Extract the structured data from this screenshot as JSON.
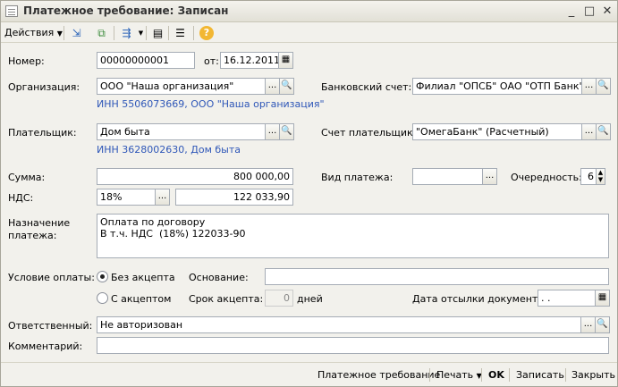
{
  "window": {
    "title": "Платежное требование: Записан",
    "minimize": "_",
    "maximize": "□",
    "close": "✕"
  },
  "toolbar": {
    "actions_label": "Действия",
    "help": "?"
  },
  "form": {
    "number_label": "Номер:",
    "number_value": "00000000001",
    "from_label": "от:",
    "date_value": "16.12.2011",
    "org_label": "Организация:",
    "org_value": "ООО \"Наша организация\"",
    "org_inn": "ИНН 5506073669, ООО \"Наша организация\"",
    "bank_account_label": "Банковский счет:",
    "bank_account_value": "Филиал \"ОПСБ\" ОАО \"ОТП Банк\" (Р",
    "payer_label": "Плательщик:",
    "payer_value": "Дом  быта",
    "payer_inn": "ИНН 3628002630, Дом  быта",
    "payer_account_label": "Счет плательщика:",
    "payer_account_value": "\"ОмегаБанк\" (Расчетный)",
    "sum_label": "Сумма:",
    "sum_value": "800 000,00",
    "payment_type_label": "Вид платежа:",
    "payment_type_value": "",
    "priority_label": "Очередность:",
    "priority_value": "6",
    "vat_label": "НДС:",
    "vat_rate": "18%",
    "vat_sum": "122 033,90",
    "purpose_label_1": "Назначение",
    "purpose_label_2": "платежа:",
    "purpose_text": "Оплата по договору\nВ т.ч. НДС  (18%) 122033-90",
    "payment_condition_label": "Условие оплаты:",
    "without_acceptance": "Без акцепта",
    "with_acceptance": "С акцептом",
    "basis_label": "Основание:",
    "basis_value": "",
    "acceptance_term_label": "Срок акцепта:",
    "acceptance_term_value": "0",
    "days_label": "дней",
    "docs_date_label": "Дата отсылки документов:",
    "docs_date_value": " .  .",
    "responsible_label": "Ответственный:",
    "responsible_value": "Не авторизован",
    "comment_label": "Комментарий:",
    "comment_value": ""
  },
  "bottom": {
    "payment_request": "Платежное требование",
    "print": "Печать",
    "ok": "OK",
    "save": "Записать",
    "close": "Закрыть"
  },
  "colors": {
    "link_blue": "#2f57b8",
    "window_bg": "#f2f1ec",
    "field_border": "#a5acb5"
  }
}
